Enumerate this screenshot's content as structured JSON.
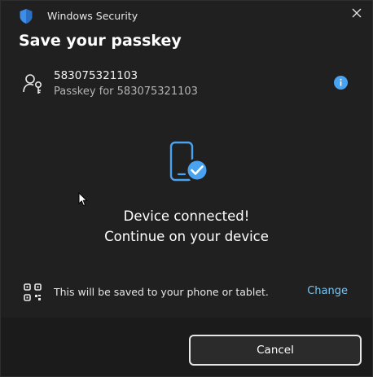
{
  "window": {
    "app_title": "Windows Security",
    "close_icon": "close-icon"
  },
  "dialog": {
    "heading": "Save your passkey"
  },
  "account": {
    "name": "583075321103",
    "subtitle": "Passkey for 583075321103",
    "icon": "key-person-icon",
    "info_icon": "info-icon"
  },
  "status": {
    "illustration": "phone-check-icon",
    "line1": "Device connected!",
    "line2": "Continue on your device"
  },
  "save_location": {
    "icon": "qr-code-icon",
    "text": "This will be saved to your phone or tablet.",
    "change_label": "Change"
  },
  "footer": {
    "cancel_label": "Cancel"
  },
  "colors": {
    "background": "#202020",
    "footer": "#1b1b1b",
    "accent": "#4aa3f0",
    "link": "#7cc4ef"
  }
}
